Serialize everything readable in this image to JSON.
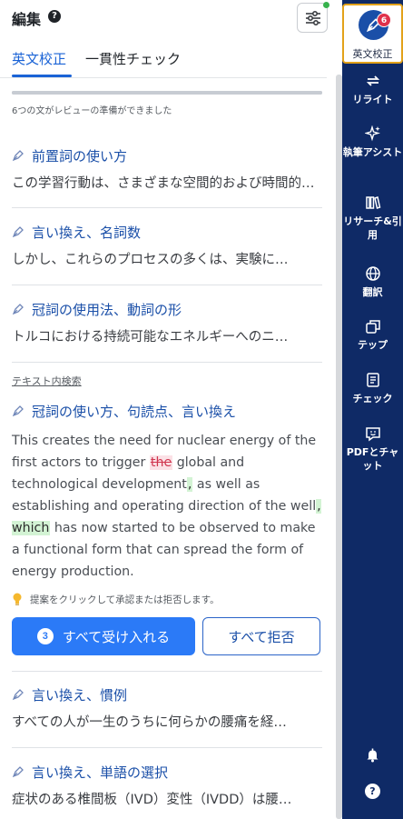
{
  "header": {
    "title": "編集",
    "help": "?"
  },
  "tabs": [
    {
      "label": "英文校正",
      "active": true
    },
    {
      "label": "一貫性チェック",
      "active": false
    }
  ],
  "progress": {
    "fraction": 1.0,
    "status": "6つの文がレビューの準備ができました"
  },
  "cards": [
    {
      "title": "前置詞の使い方",
      "snippet": "この学習行動は、さまざまな空間的および時間的…"
    },
    {
      "title": "言い換え、名詞数",
      "snippet": "しかし、これらのプロセスの多くは、実験に…"
    },
    {
      "title": "冠詞の使用法、動詞の形",
      "snippet": "トルコにおける持続可能なエネルギーへのニ…"
    }
  ],
  "section_label": "テキスト内検索",
  "expanded_card": {
    "title": "冠詞の使い方、句読点、言い換え",
    "text_1": "This creates the need for nuclear energy of the first actors to trigger ",
    "deleted": "the",
    "text_2": " global and technological development",
    "insert_1": ",",
    "text_3": " as well as establishing and operating direction of the well",
    "insert_2": ", which",
    "text_4": " has now started to be observed to make a functional form that can spread the form of energy production."
  },
  "hint": "提案をクリックして承認または拒否します。",
  "actions": {
    "accept_count": "3",
    "accept_label": "すべて受け入れる",
    "reject_label": "すべて拒否"
  },
  "cards_bottom": [
    {
      "title": "言い換え、慣例",
      "snippet": "すべての人が一生のうちに何らかの腰痛を経…"
    },
    {
      "title": "言い換え、単語の選択",
      "snippet": "症状のある椎間板（IVD）変性（IVDD）は腰…"
    }
  ],
  "sidebar": {
    "active": {
      "label": "英文校正",
      "badge": "6"
    },
    "items": [
      {
        "label": "リライト",
        "icon": "rewrite-arrows-icon"
      },
      {
        "label": "執筆アシスト",
        "icon": "sparkle-icon"
      },
      {
        "label": "リサーチ&引用",
        "icon": "books-icon"
      },
      {
        "label": "翻訳",
        "icon": "globe-icon"
      },
      {
        "label": "テップ",
        "icon": "copy-windows-icon"
      },
      {
        "label": "チェック",
        "icon": "checklist-icon"
      },
      {
        "label": "PDFとチャット",
        "icon": "chat-pdf-icon"
      }
    ],
    "bottom": [
      {
        "icon": "bell-icon"
      },
      {
        "icon": "help-circle-icon",
        "glyph": "?"
      }
    ]
  },
  "colors": {
    "accent": "#1a63d6",
    "sidebar_bg": "#0f2a66",
    "badge": "#e0324b",
    "active_border": "#e3a21a",
    "insert_bg": "#d3f3d4",
    "delete_color": "#d0354f"
  }
}
